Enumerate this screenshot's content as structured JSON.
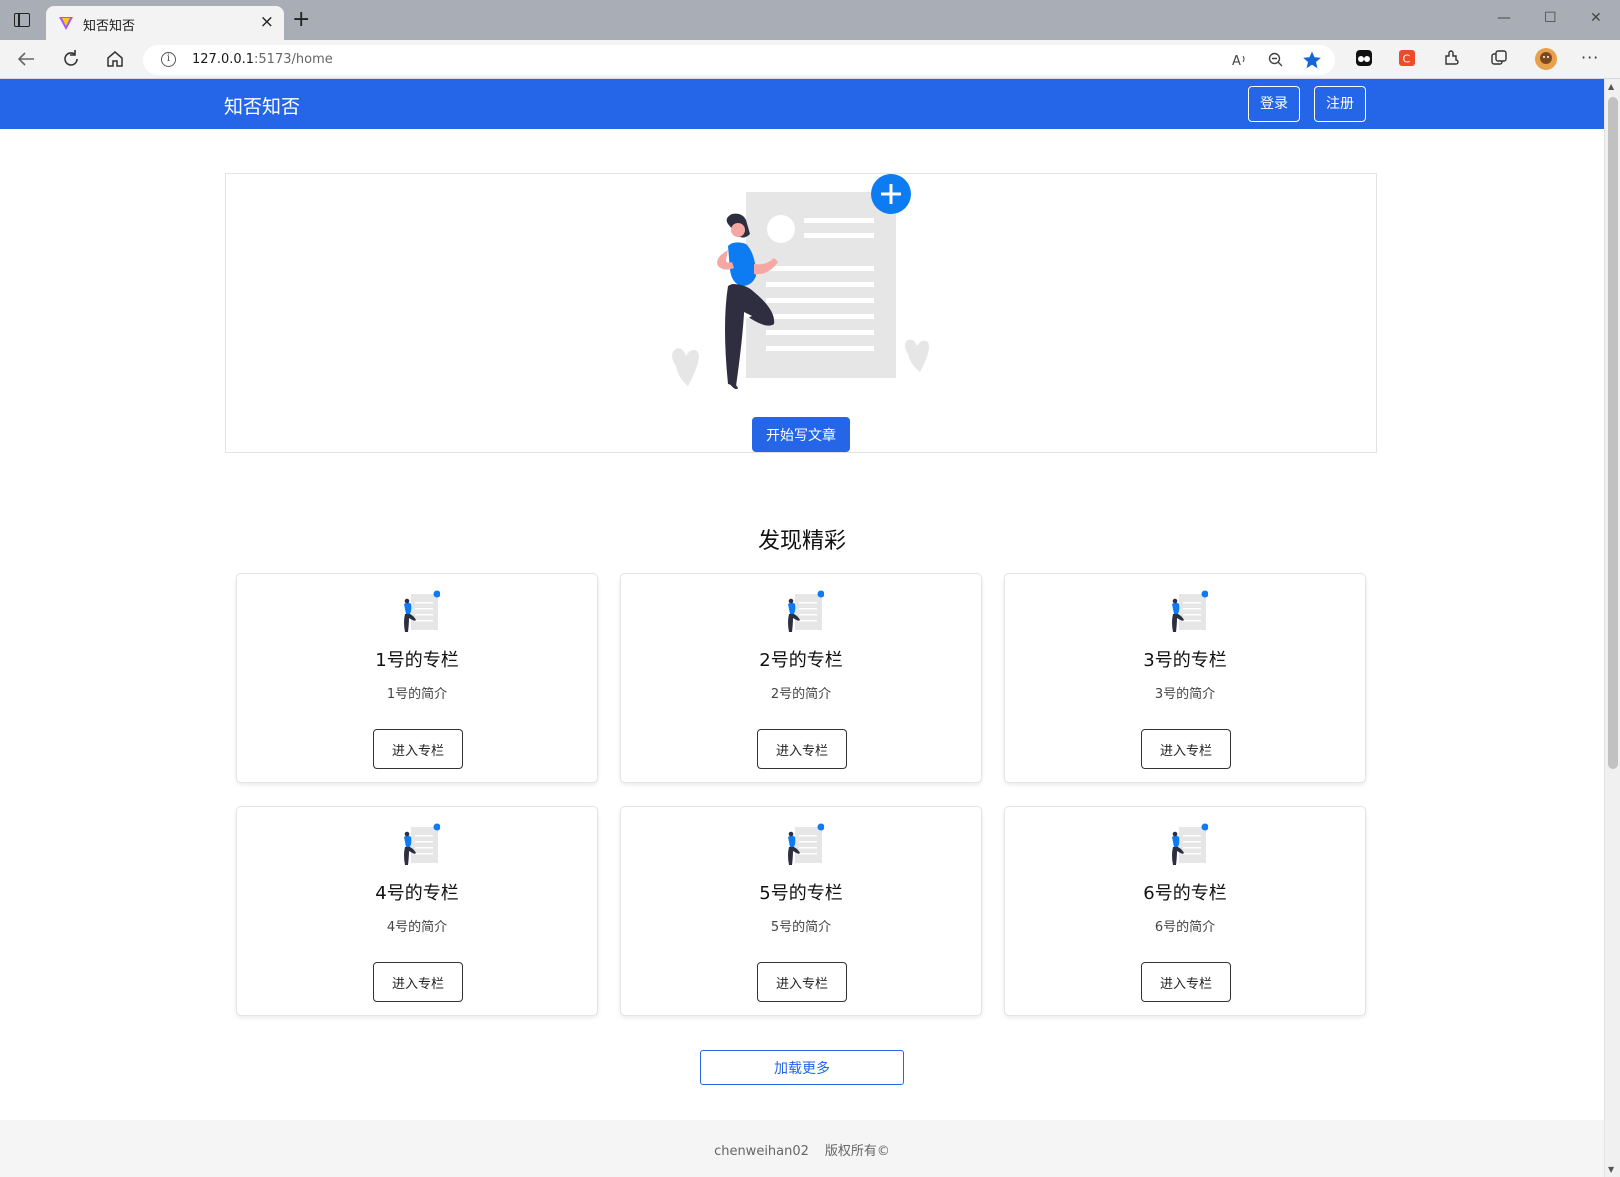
{
  "browser": {
    "tab_title": "知否知否",
    "tab_close": "×",
    "new_tab": "+",
    "url_host": "127.0.0.1",
    "url_rest": ":5173/home",
    "window_controls": [
      "—",
      "☐",
      "✕"
    ]
  },
  "navbar": {
    "brand": "知否知否",
    "login_label": "登录",
    "register_label": "注册"
  },
  "hero": {
    "write_button": "开始写文章"
  },
  "section": {
    "title": "发现精彩"
  },
  "columns": [
    {
      "title": "1号的专栏",
      "desc": "1号的简介",
      "button": "进入专栏"
    },
    {
      "title": "2号的专栏",
      "desc": "2号的简介",
      "button": "进入专栏"
    },
    {
      "title": "3号的专栏",
      "desc": "3号的简介",
      "button": "进入专栏"
    },
    {
      "title": "4号的专栏",
      "desc": "4号的简介",
      "button": "进入专栏"
    },
    {
      "title": "5号的专栏",
      "desc": "5号的简介",
      "button": "进入专栏"
    },
    {
      "title": "6号的专栏",
      "desc": "6号的简介",
      "button": "进入专栏"
    }
  ],
  "load_more": "加载更多",
  "footer": {
    "author": "chenweihan02",
    "copyright": "版权所有©"
  },
  "colors": {
    "brand_blue": "#2565e8",
    "accent_blue": "#0d7bf2"
  },
  "icons": [
    "window-icon",
    "vite-favicon",
    "back-icon",
    "refresh-icon",
    "home-icon",
    "info-icon",
    "read-aloud-icon",
    "zoom-out-icon",
    "favorite-star-icon",
    "extensions-icon",
    "collections-icon",
    "profile-avatar-icon",
    "more-menu-icon",
    "plus-circle-icon"
  ]
}
